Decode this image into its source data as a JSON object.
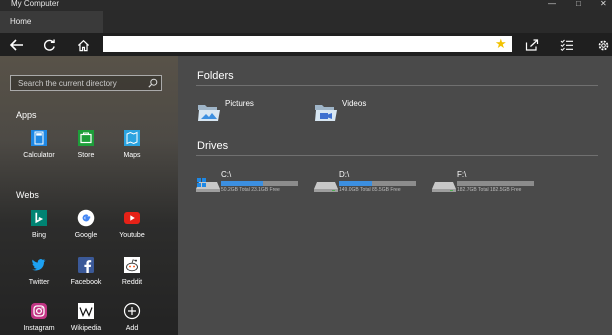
{
  "window": {
    "title": "My Computer"
  },
  "tab": {
    "label": "Home"
  },
  "address": {
    "value": ""
  },
  "sidebar": {
    "search_placeholder": "Search the current directory",
    "apps_heading": "Apps",
    "apps": [
      {
        "label": "Calculator",
        "icon": "calculator-icon",
        "color": "#1e88e5"
      },
      {
        "label": "Store",
        "icon": "store-icon",
        "color": "#1e9e3a"
      },
      {
        "label": "Maps",
        "icon": "maps-icon",
        "color": "#2aa3e0"
      }
    ],
    "webs_heading": "Webs",
    "webs": [
      {
        "label": "Bing",
        "icon": "bing-icon",
        "color": "#008373"
      },
      {
        "label": "Google",
        "icon": "google-icon",
        "color": "#ffffff"
      },
      {
        "label": "Youtube",
        "icon": "youtube-icon",
        "color": "#e62117"
      },
      {
        "label": "Twitter",
        "icon": "twitter-icon",
        "color": "#1da1f2"
      },
      {
        "label": "Facebook",
        "icon": "facebook-icon",
        "color": "#3b5998"
      },
      {
        "label": "Reddit",
        "icon": "reddit-icon",
        "color": "#ffffff"
      },
      {
        "label": "Instagram",
        "icon": "instagram-icon",
        "color": "#c13584"
      },
      {
        "label": "Wikipedia",
        "icon": "wikipedia-icon",
        "color": "#ffffff"
      },
      {
        "label": "Add",
        "icon": "add-icon",
        "color": "#ffffff"
      }
    ]
  },
  "main": {
    "folders_heading": "Folders",
    "folders": [
      {
        "label": "Pictures",
        "icon": "pictures-folder-icon"
      },
      {
        "label": "Videos",
        "icon": "videos-folder-icon"
      }
    ],
    "drives_heading": "Drives",
    "drives": [
      {
        "name": "C:\\",
        "size_text": "50.2GB Total  23.1GB Free",
        "used_fraction": 0.54,
        "icon": "system-drive-icon"
      },
      {
        "name": "D:\\",
        "size_text": "149.0GB Total  85.5GB Free",
        "used_fraction": 0.43,
        "icon": "drive-icon"
      },
      {
        "name": "F:\\",
        "size_text": "182.7GB Total  182.5GB Free",
        "used_fraction": 0.0,
        "icon": "drive-icon"
      }
    ]
  },
  "colors": {
    "accent": "#3c8fe0",
    "star": "#f2c200"
  }
}
